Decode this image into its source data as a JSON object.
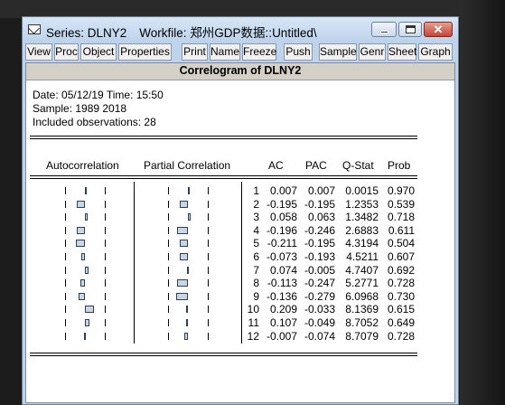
{
  "window": {
    "series_label": "Series: DLNY2",
    "workfile_label": "Workfile: 郑州GDP数据::Untitled\\"
  },
  "toolbar": [
    "View",
    "Proc",
    "Object",
    "Properties",
    "Print",
    "Name",
    "Freeze",
    "Push",
    "Sample",
    "Genr",
    "Sheet",
    "Graph"
  ],
  "view_title": "Correlogram of DLNY2",
  "meta": {
    "date_line": "Date: 05/12/19   Time: 15:50",
    "sample_line": "Sample: 1989 2018",
    "obs_line": "Included observations: 28"
  },
  "headers": {
    "autocorrelation": "Autocorrelation",
    "partial_correlation": "Partial Correlation",
    "ac": "AC",
    "pac": "PAC",
    "qstat": "Q-Stat",
    "prob": "Prob"
  },
  "rows": [
    {
      "lag": "1",
      "ac": "0.007",
      "pac": "0.007",
      "q": "0.0015",
      "prob": "0.970"
    },
    {
      "lag": "2",
      "ac": "-0.195",
      "pac": "-0.195",
      "q": "1.2353",
      "prob": "0.539"
    },
    {
      "lag": "3",
      "ac": "0.058",
      "pac": "0.063",
      "q": "1.3482",
      "prob": "0.718"
    },
    {
      "lag": "4",
      "ac": "-0.196",
      "pac": "-0.246",
      "q": "2.6883",
      "prob": "0.611"
    },
    {
      "lag": "5",
      "ac": "-0.211",
      "pac": "-0.195",
      "q": "4.3194",
      "prob": "0.504"
    },
    {
      "lag": "6",
      "ac": "-0.073",
      "pac": "-0.193",
      "q": "4.5211",
      "prob": "0.607"
    },
    {
      "lag": "7",
      "ac": "0.074",
      "pac": "-0.005",
      "q": "4.7407",
      "prob": "0.692"
    },
    {
      "lag": "8",
      "ac": "-0.113",
      "pac": "-0.247",
      "q": "5.2771",
      "prob": "0.728"
    },
    {
      "lag": "9",
      "ac": "-0.136",
      "pac": "-0.279",
      "q": "6.0968",
      "prob": "0.730"
    },
    {
      "lag": "10",
      "ac": "0.209",
      "pac": "-0.033",
      "q": "8.1369",
      "prob": "0.615"
    },
    {
      "lag": "11",
      "ac": "0.107",
      "pac": "-0.049",
      "q": "8.7052",
      "prob": "0.649"
    },
    {
      "lag": "12",
      "ac": "-0.007",
      "pac": "-0.074",
      "q": "8.7079",
      "prob": "0.728"
    }
  ],
  "colors": {
    "titlebar": "#bcd2ea",
    "bar_fill": "#c9d6e6",
    "close_button": "#c4453a"
  }
}
